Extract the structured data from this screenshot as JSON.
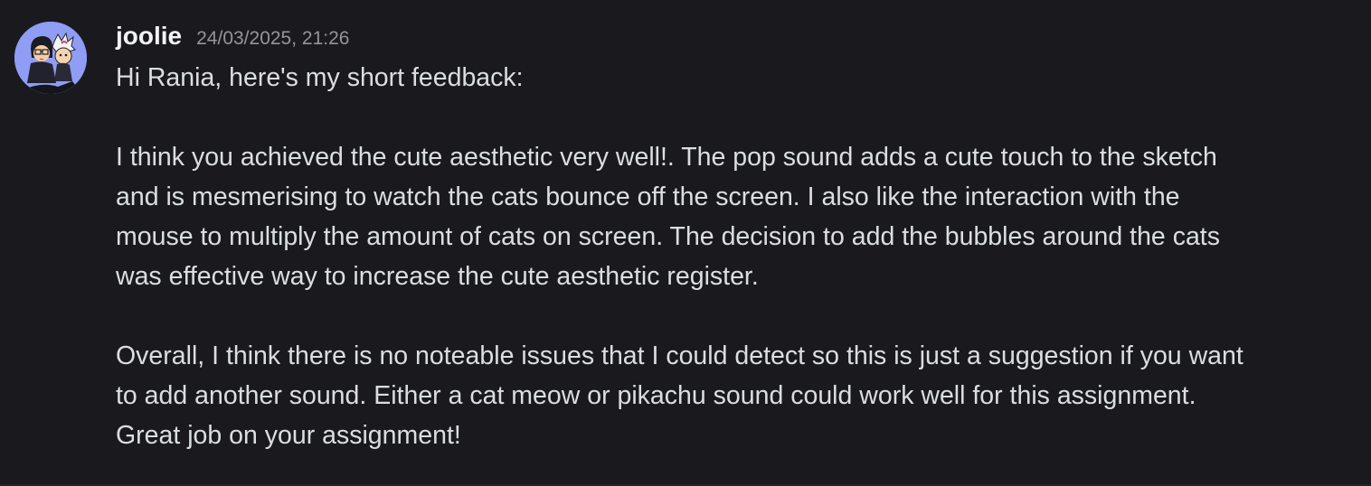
{
  "author": {
    "username": "joolie",
    "timestamp": "24/03/2025, 21:26"
  },
  "message": {
    "greeting_line": "Hi Rania, here's my short feedback:",
    "paragraph_1_lines": [
      "I think you achieved the cute aesthetic very well!. The pop sound adds a cute touch to the sketch",
      "and is mesmerising to watch the cats bounce off the screen. I also like the interaction with the",
      "mouse to multiply the amount of cats on screen. The decision to add the bubbles around the cats",
      "was effective way to increase the cute aesthetic register."
    ],
    "paragraph_2_lines": [
      "Overall, I think there is no noteable issues that I could detect so this is just a suggestion if you want",
      "to add another sound. Either a cat meow or pikachu sound could work well for this assignment.",
      "Great job on your assignment!"
    ]
  },
  "colors": {
    "background": "#1a1a1e",
    "username": "#f2f3f5",
    "timestamp": "#94959c",
    "message_text": "#dbdee1",
    "avatar_background": "#8f9df5"
  },
  "icons": {
    "avatar": "user-avatar-illustration"
  }
}
